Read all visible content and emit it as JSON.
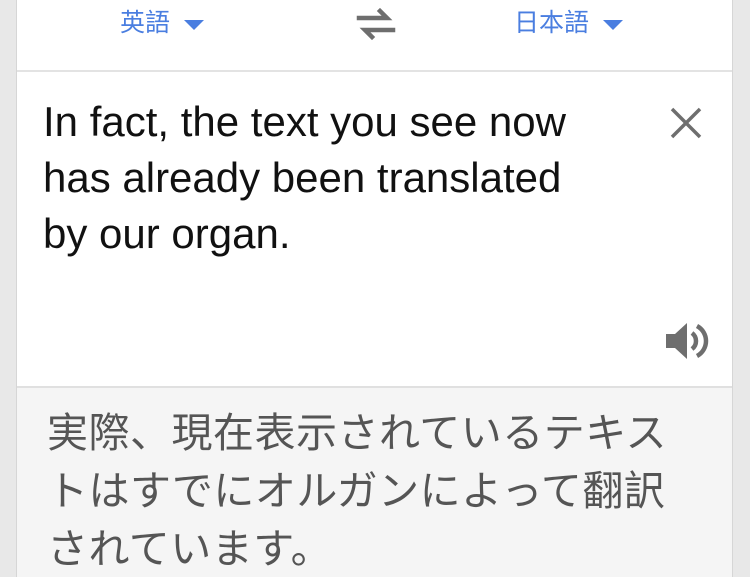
{
  "language_bar": {
    "source_language": "英語",
    "target_language": "日本語",
    "caret_icon": "caret-down-icon",
    "swap_icon": "swap-arrows-icon"
  },
  "input": {
    "text": "In fact, the text you see now has already been translated by our organ.",
    "clear_icon": "close-icon",
    "listen_icon": "speaker-icon"
  },
  "output": {
    "text": "実際、現在表示されているテキストはすでにオルガンによって翻訳されています。"
  },
  "colors": {
    "accent": "#4a7ee0",
    "icon_gray": "#6e6e6e",
    "output_background": "#f5f5f5"
  }
}
